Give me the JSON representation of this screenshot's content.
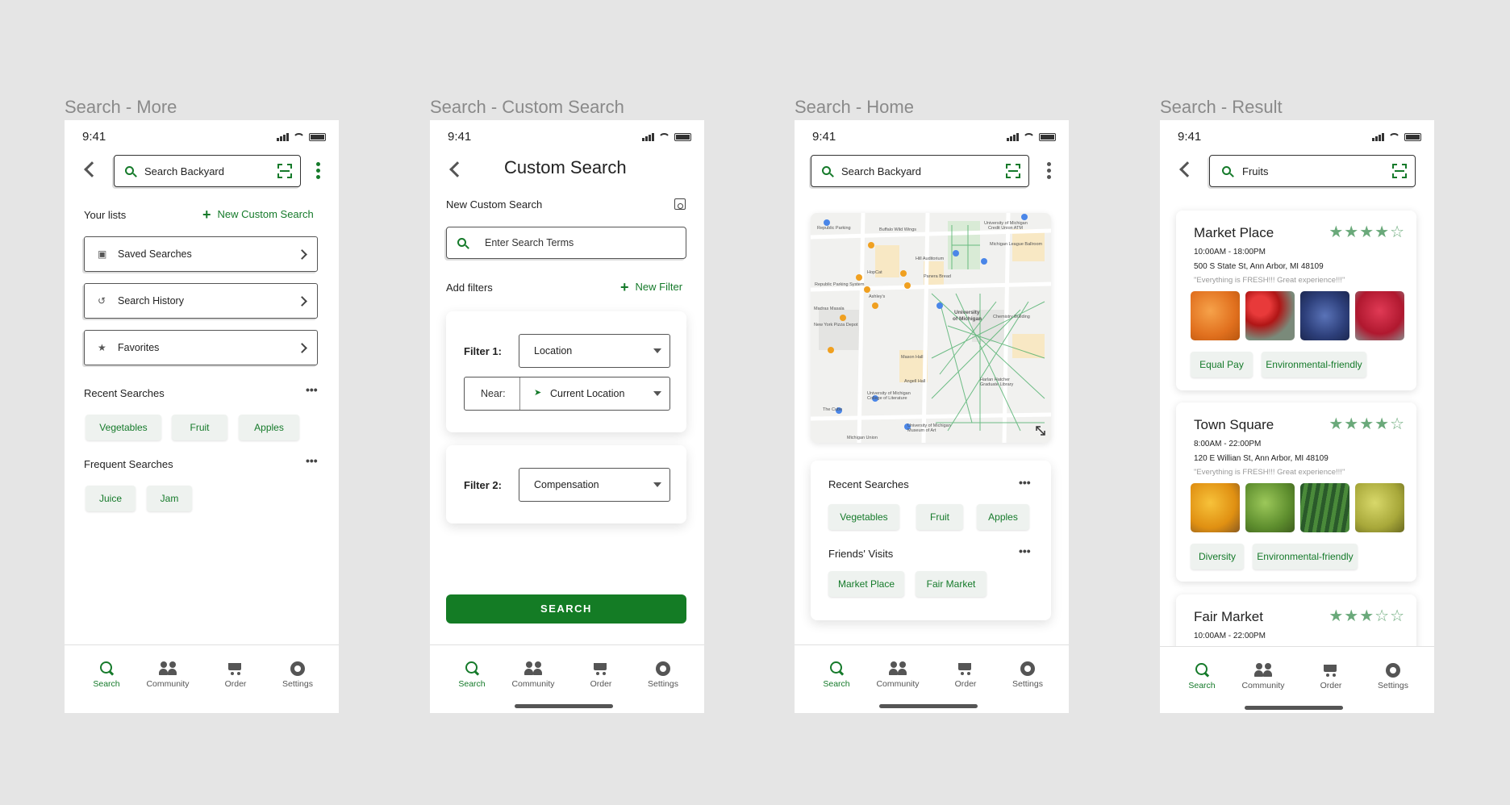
{
  "brand": {
    "accent": "#157a2a",
    "chip_bg": "#eef2ef",
    "button": "#147c25"
  },
  "status": {
    "time": "9:41"
  },
  "tabs": [
    {
      "label": "Search",
      "icon": "search-icon"
    },
    {
      "label": "Community",
      "icon": "community-icon"
    },
    {
      "label": "Order",
      "icon": "cart-icon"
    },
    {
      "label": "Settings",
      "icon": "gear-icon"
    }
  ],
  "screens": {
    "more": {
      "frame_title": "Search - More",
      "search_placeholder": "Search Backyard",
      "your_lists": "Your lists",
      "new_custom_search": "New Custom Search",
      "lists": [
        "Saved Searches",
        "Search History",
        "Favorites"
      ],
      "recent_searches_title": "Recent Searches",
      "recent": [
        "Vegetables",
        "Fruit",
        "Apples"
      ],
      "frequent_searches_title": "Frequent Searches",
      "frequent": [
        "Juice",
        "Jam"
      ]
    },
    "custom": {
      "frame_title": "Search - Custom Search",
      "header": "Custom Search",
      "new_custom_search": "New Custom Search",
      "search_terms_placeholder": "Enter Search Terms",
      "add_filters": "Add filters",
      "new_filter": "New Filter",
      "filter1_label": "Filter 1:",
      "filter1_value": "Location",
      "near_label": "Near:",
      "near_value": "Current Location",
      "filter2_label": "Filter 2:",
      "filter2_value": "Compensation",
      "search_button": "SEARCH"
    },
    "home": {
      "frame_title": "Search - Home",
      "search_placeholder": "Search Backyard",
      "map_labels": [
        "Republic Parking",
        "Buffalo Wild Wings",
        "University of Michigan Credit Union ATM",
        "Hill Auditorium",
        "Michigan League Ballroom",
        "HopCat",
        "Panera Bread",
        "Republic Parking System",
        "Ashley's",
        "Madras Masala",
        "University of Michigan",
        "Chemistry Building",
        "New York Pizza Depot",
        "Mason Hall",
        "Angell Hall",
        "Harlan Hatcher Graduate Library",
        "University of Michigan College of Literature",
        "The Cube",
        "University of Michigan Museum of Art",
        "Michigan Union"
      ],
      "recent_title": "Recent Searches",
      "recent": [
        "Vegetables",
        "Fruit",
        "Apples"
      ],
      "friends_title": "Friends' Visits",
      "friends": [
        "Market Place",
        "Fair Market"
      ]
    },
    "result": {
      "frame_title": "Search - Result",
      "search_value": "Fruits",
      "results": [
        {
          "name": "Market Place",
          "rating": 4,
          "hours": "10:00AM - 18:00PM",
          "address": "500 S State St, Ann Arbor, MI 48109",
          "quote": "\"Everything is FRESH!!! Great experience!!!\"",
          "photos": [
            "oranges",
            "strawberries",
            "blueberries",
            "raspberries"
          ],
          "tags": [
            "Equal Pay",
            "Environmental-friendly"
          ]
        },
        {
          "name": "Town Square",
          "rating": 4,
          "hours": "8:00AM - 22:00PM",
          "address": "120 E Willian St, Ann Arbor, MI 48109",
          "quote": "\"Everything is FRESH!!! Great experience!!!\"",
          "photos": [
            "mangoes",
            "limes",
            "watermelons",
            "pears"
          ],
          "tags": [
            "Diversity",
            "Environmental-friendly"
          ]
        },
        {
          "name": "Fair Market",
          "rating": 3,
          "hours": "10:00AM - 22:00PM"
        }
      ]
    }
  }
}
